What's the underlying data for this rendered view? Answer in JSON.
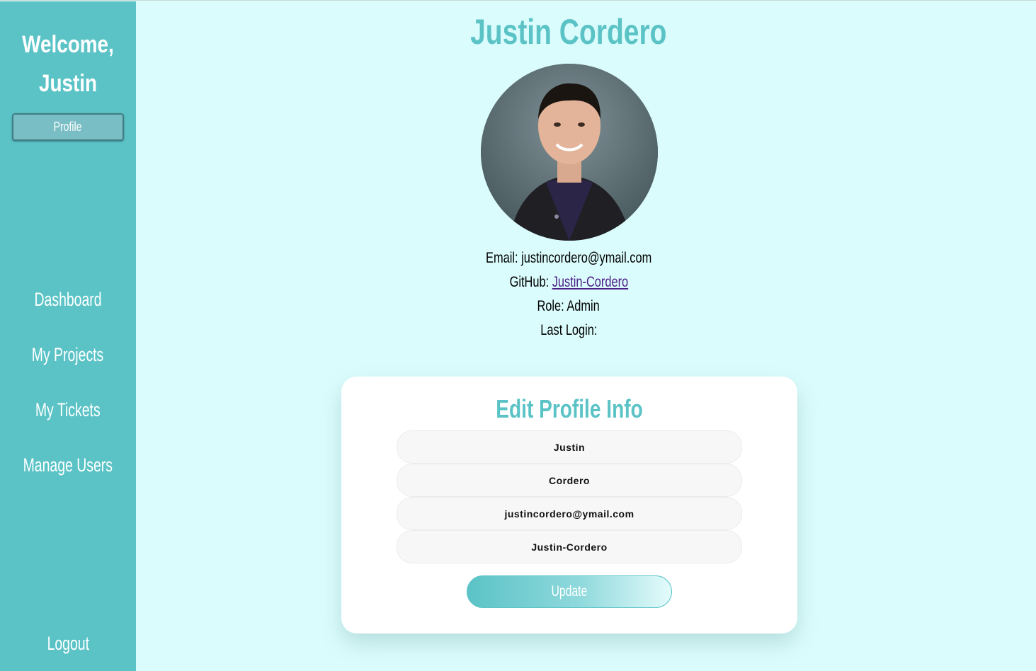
{
  "sidebar": {
    "welcome_line1": "Welcome,",
    "welcome_line2": "Justin",
    "profile_button": "Profile",
    "nav": {
      "dashboard": "Dashboard",
      "my_projects": "My Projects",
      "my_tickets": "My Tickets",
      "manage_users": "Manage Users",
      "logout": "Logout"
    }
  },
  "profile": {
    "full_name": "Justin Cordero",
    "email_label": "Email:",
    "email": "justincordero@ymail.com",
    "github_label": "GitHub:",
    "github": "Justin-Cordero",
    "role_label": "Role:",
    "role": "Admin",
    "last_login_label": "Last Login:",
    "last_login": ""
  },
  "edit_form": {
    "title": "Edit Profile Info",
    "first_name": "Justin",
    "last_name": "Cordero",
    "email": "justincordero@ymail.com",
    "github": "Justin-Cordero",
    "update_button": "Update"
  },
  "colors": {
    "accent": "#5bc3c6",
    "background": "#dbfcfc",
    "link": "#4b1d86"
  }
}
